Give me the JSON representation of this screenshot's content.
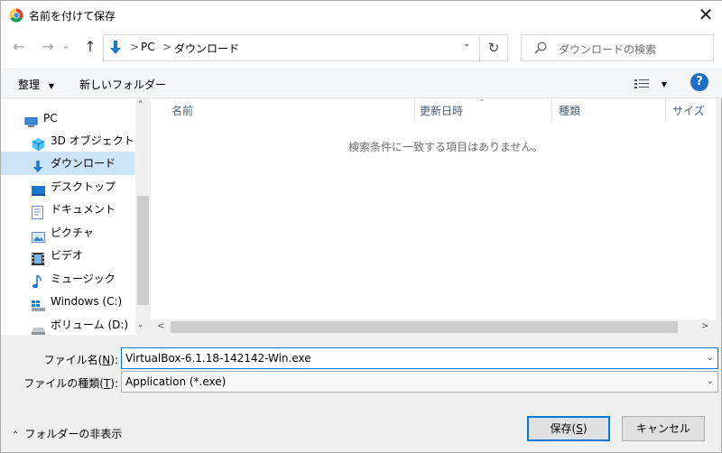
{
  "window": {
    "title": "名前を付けて保存",
    "close_glyph": "✕"
  },
  "nav": {
    "back_glyph": "←",
    "forward_glyph": "→",
    "recent_glyph": "⌄",
    "up_glyph": "↑",
    "refresh_glyph": "↻"
  },
  "address": {
    "crumbs": [
      "PC",
      "ダウンロード"
    ],
    "separator": ">"
  },
  "search": {
    "placeholder": "ダウンロードの検索"
  },
  "toolbar": {
    "organize_label": "整理",
    "new_folder_label": "新しいフォルダー",
    "help_label": "?"
  },
  "navpane": {
    "items": [
      {
        "label": "PC",
        "icon": "pc-icon"
      },
      {
        "label": "3D オブジェクト",
        "icon": "3d-objects-icon"
      },
      {
        "label": "ダウンロード",
        "icon": "download-icon",
        "selected": true
      },
      {
        "label": "デスクトップ",
        "icon": "desktop-icon"
      },
      {
        "label": "ドキュメント",
        "icon": "documents-icon"
      },
      {
        "label": "ピクチャ",
        "icon": "pictures-icon"
      },
      {
        "label": "ビデオ",
        "icon": "videos-icon"
      },
      {
        "label": "ミュージック",
        "icon": "music-icon"
      },
      {
        "label": "Windows (C:)",
        "icon": "drive-c-icon"
      },
      {
        "label": "ボリューム (D:)",
        "icon": "drive-d-icon"
      }
    ]
  },
  "filelist": {
    "columns": [
      "名前",
      "更新日時",
      "種類",
      "サイズ"
    ],
    "empty_message": "検索条件に一致する項目はありません。"
  },
  "form": {
    "filename_label_pre": "ファイル名(",
    "filename_label_key": "N",
    "filename_label_post": "):",
    "filename_value": "VirtualBox-6.1.18-142142-Win.exe",
    "filetype_label_pre": "ファイルの種類(",
    "filetype_label_key": "T",
    "filetype_label_post": "):",
    "filetype_value": "Application (*.exe)"
  },
  "footer": {
    "hide_folders_label": "フォルダーの非表示",
    "save_label_pre": "保存(",
    "save_label_key": "S",
    "save_label_post": ")",
    "cancel_label": "キャンセル"
  },
  "colors": {
    "accent": "#0078d7",
    "selection": "#cce4f7"
  }
}
